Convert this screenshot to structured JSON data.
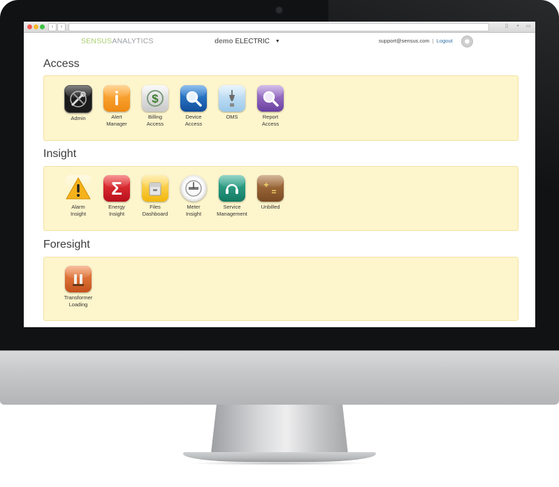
{
  "header": {
    "brand_part1": "SENSUS",
    "brand_part2": "ANALYTICS",
    "org_prefix": "demo",
    "org_name": "ELECTRIC",
    "org_caret": "▼",
    "user_email": "support@sensus.com",
    "separator": "|",
    "logout_label": "Logout"
  },
  "sections": {
    "access": {
      "title": "Access",
      "tiles": [
        {
          "label": "Admin",
          "icon": "admin-tools-icon"
        },
        {
          "label": "Alert\nManager",
          "icon": "alert-manager-icon"
        },
        {
          "label": "Billing\nAccess",
          "icon": "billing-dollar-icon"
        },
        {
          "label": "Device\nAccess",
          "icon": "device-search-icon"
        },
        {
          "label": "OMS",
          "icon": "oms-icon"
        },
        {
          "label": "Report\nAccess",
          "icon": "report-search-icon"
        }
      ]
    },
    "insight": {
      "title": "Insight",
      "tiles": [
        {
          "label": "Alarm\nInsight",
          "icon": "warning-icon"
        },
        {
          "label": "Energy\nInsight",
          "icon": "sigma-icon"
        },
        {
          "label": "Files\nDashboard",
          "icon": "files-icon"
        },
        {
          "label": "Meter\nInsight",
          "icon": "meter-icon"
        },
        {
          "label": "Service\nManagement",
          "icon": "service-icon"
        },
        {
          "label": "Unbilled",
          "icon": "calculator-icon"
        }
      ]
    },
    "foresight": {
      "title": "Foresight",
      "tiles": [
        {
          "label": "Transformer\nLoading",
          "icon": "transformer-icon"
        }
      ]
    }
  },
  "colors": {
    "panel_bg": "#fdf5cc",
    "brand_green": "#a7cf6e",
    "link_blue": "#2e6da4"
  }
}
